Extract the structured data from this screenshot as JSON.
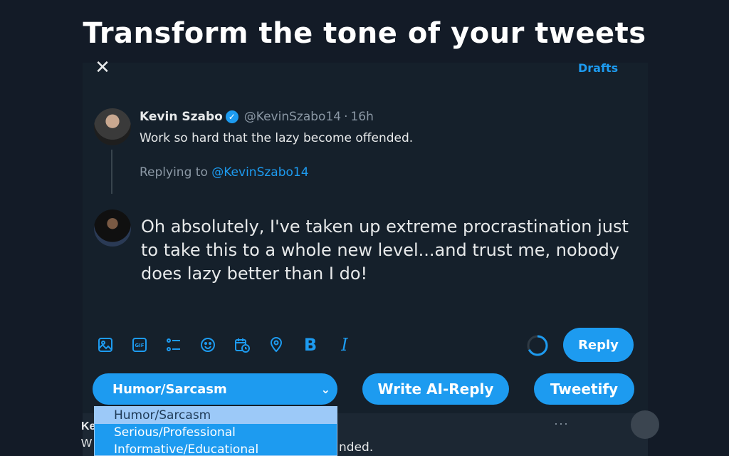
{
  "headline": "Transform the tone of your tweets",
  "composer": {
    "close_icon": "close-icon",
    "drafts_label": "Drafts"
  },
  "original_tweet": {
    "author_name": "Kevin Szabo",
    "verified": true,
    "handle": "@KevinSzabo14",
    "separator": "·",
    "time": "16h",
    "text": "Work so hard that the lazy become offended."
  },
  "replying": {
    "prefix": "Replying to",
    "handle": "@KevinSzabo14"
  },
  "reply": {
    "text": "Oh absolutely, I've taken up extreme procrastination just to take this to a whole new level...and trust me, nobody does lazy better than I do!"
  },
  "toolbar": {
    "icons": [
      "image-icon",
      "gif-icon",
      "poll-icon",
      "emoji-icon",
      "schedule-icon",
      "location-icon",
      "bold-icon",
      "italic-icon"
    ],
    "bold_glyph": "B",
    "italic_glyph": "I",
    "reply_label": "Reply"
  },
  "tone": {
    "selected": "Humor/Sarcasm",
    "options": [
      "Humor/Sarcasm",
      "Serious/Professional",
      "Informative/Educational"
    ],
    "write_ai_reply_label": "Write AI-Reply",
    "tweetify_label": "Tweetify"
  },
  "background_tweet": {
    "name_fragment": "Ke",
    "text_prefix_fragment": "W",
    "text_fragment": "nded.",
    "more_glyph": "···"
  },
  "colors": {
    "accent": "#1d9bf0",
    "background": "#15202b",
    "muted_text": "#8b98a5"
  }
}
